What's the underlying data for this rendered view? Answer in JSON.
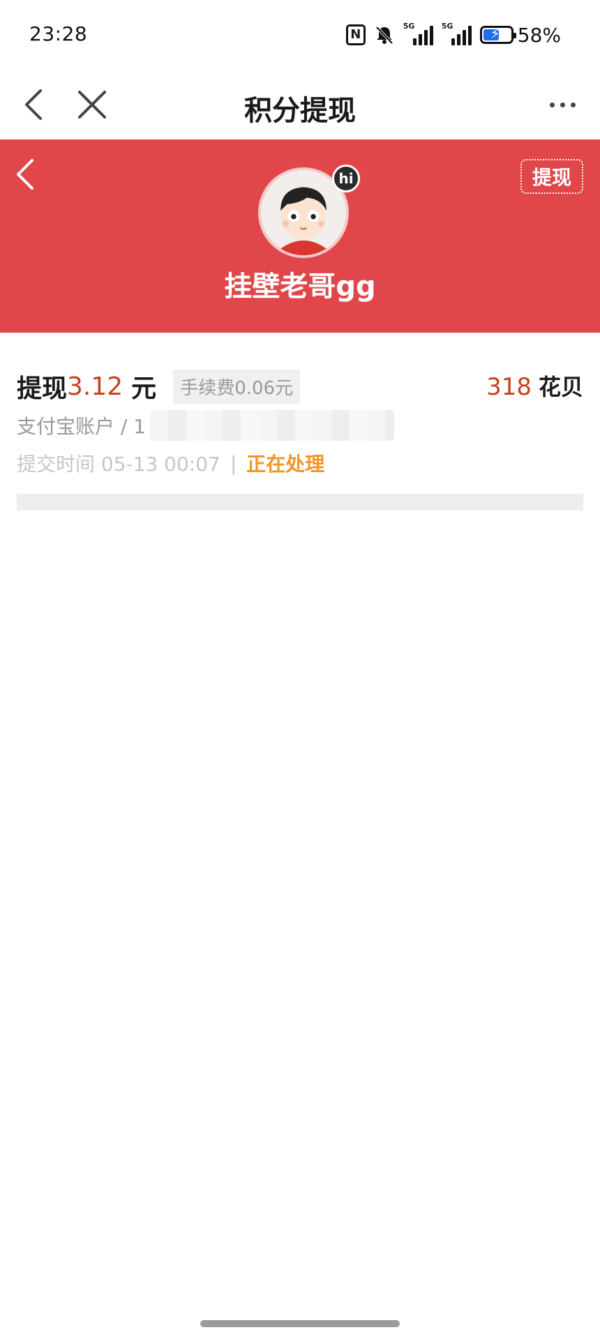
{
  "status_bar": {
    "time": "23:28",
    "nfc_label": "N",
    "signal1_tag": "5G",
    "signal2_tag": "5G",
    "battery_percent": "58%",
    "battery_level": 0.58
  },
  "nav": {
    "title": "积分提现",
    "icons": {
      "back": "chevron-left-icon",
      "close": "close-icon",
      "more": "more-horizontal-icon"
    }
  },
  "hero": {
    "background_color": "#e1474a",
    "withdraw_button": "提现",
    "avatar_badge": "hi",
    "username": "挂壁老哥gg"
  },
  "record": {
    "label": "提现",
    "amount": "3.12",
    "unit": "元",
    "fee": "手续费0.06元",
    "points_value": "318",
    "points_unit": "花贝",
    "account_prefix": "支付宝账户 / 1",
    "submit_time": "提交时间 05-13 00:07",
    "separator": "|",
    "status": "正在处理",
    "accent_color": "#c8401c",
    "status_color": "#f29521"
  }
}
